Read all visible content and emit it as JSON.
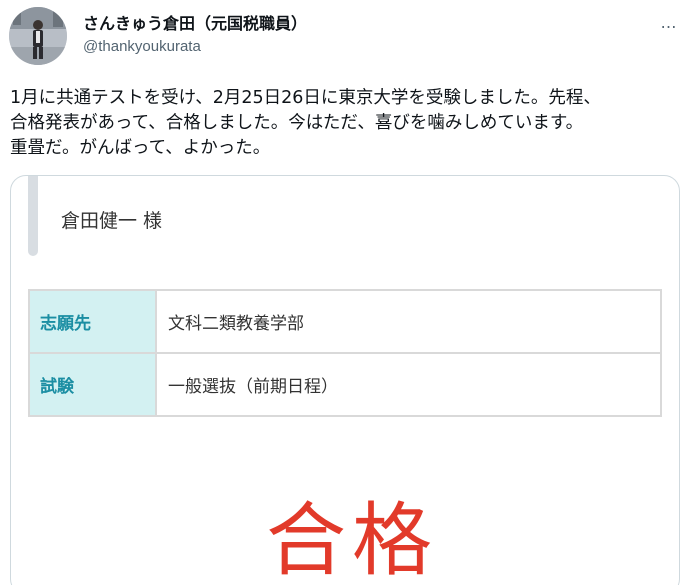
{
  "tweet": {
    "display_name": "さんきゅう倉田（元国税職員）",
    "handle": "@thankyoukurata",
    "more_icon": "…",
    "text_lines": [
      "1月に共通テストを受け、2月25日26日に東京大学を受験しました。先程、",
      "合格発表があって、合格しました。今はただ、喜びを噛みしめています。",
      "重畳だ。がんばって、よかった。"
    ]
  },
  "card": {
    "recipient": "倉田健一 様",
    "rows": [
      {
        "label": "志願先",
        "value": "文科二類教養学部"
      },
      {
        "label": "試験",
        "value": "一般選抜（前期日程）"
      }
    ],
    "result": "合格"
  },
  "colors": {
    "result_red": "#e23a2a",
    "label_bg": "#d3f1f2",
    "label_text": "#1b8ea3",
    "handle_gray": "#536471"
  }
}
